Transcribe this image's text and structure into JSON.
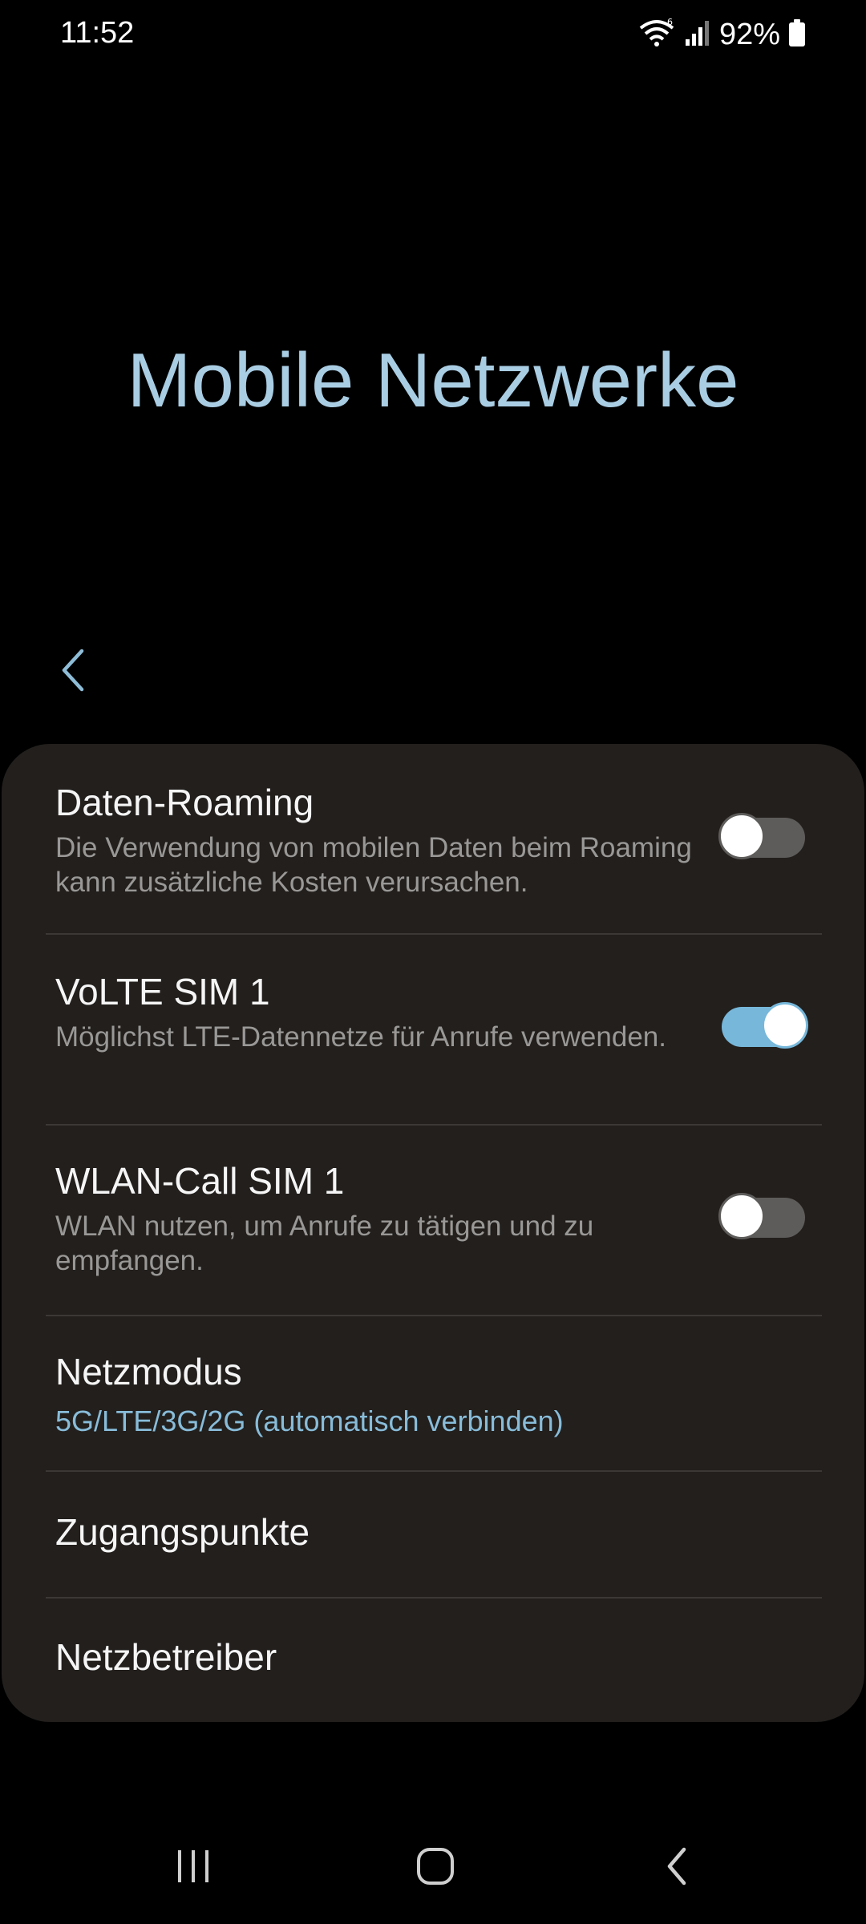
{
  "status_bar": {
    "time": "11:52",
    "battery_percent": "92%",
    "icons": [
      "wifi-icon",
      "signal-icon",
      "battery-icon"
    ]
  },
  "header": {
    "title": "Mobile Netzwerke",
    "back_icon": "chevron-left-icon"
  },
  "settings": {
    "items": [
      {
        "title": "Daten-Roaming",
        "description": "Die Verwendung von mobilen Daten beim Roaming kann zusätzliche Kosten verursachen.",
        "toggle": false
      },
      {
        "title": "VoLTE SIM 1",
        "description": "Möglichst LTE-Datennetze für Anrufe verwenden.",
        "toggle": true
      },
      {
        "title": "WLAN-Call SIM 1",
        "description": "WLAN nutzen, um Anrufe zu tätigen und zu empfangen.",
        "toggle": false
      },
      {
        "title": "Netzmodus",
        "value": "5G/LTE/3G/2G (automatisch verbinden)"
      },
      {
        "title": "Zugangspunkte"
      },
      {
        "title": "Netzbetreiber"
      }
    ]
  },
  "nav_bar": {
    "icons": [
      "recent-apps-icon",
      "home-icon",
      "back-icon"
    ]
  },
  "colors": {
    "background": "#000000",
    "card": "#221f1d",
    "accent": "#76b7da",
    "title": "#a9cde3",
    "value_text": "#88bcd9"
  }
}
